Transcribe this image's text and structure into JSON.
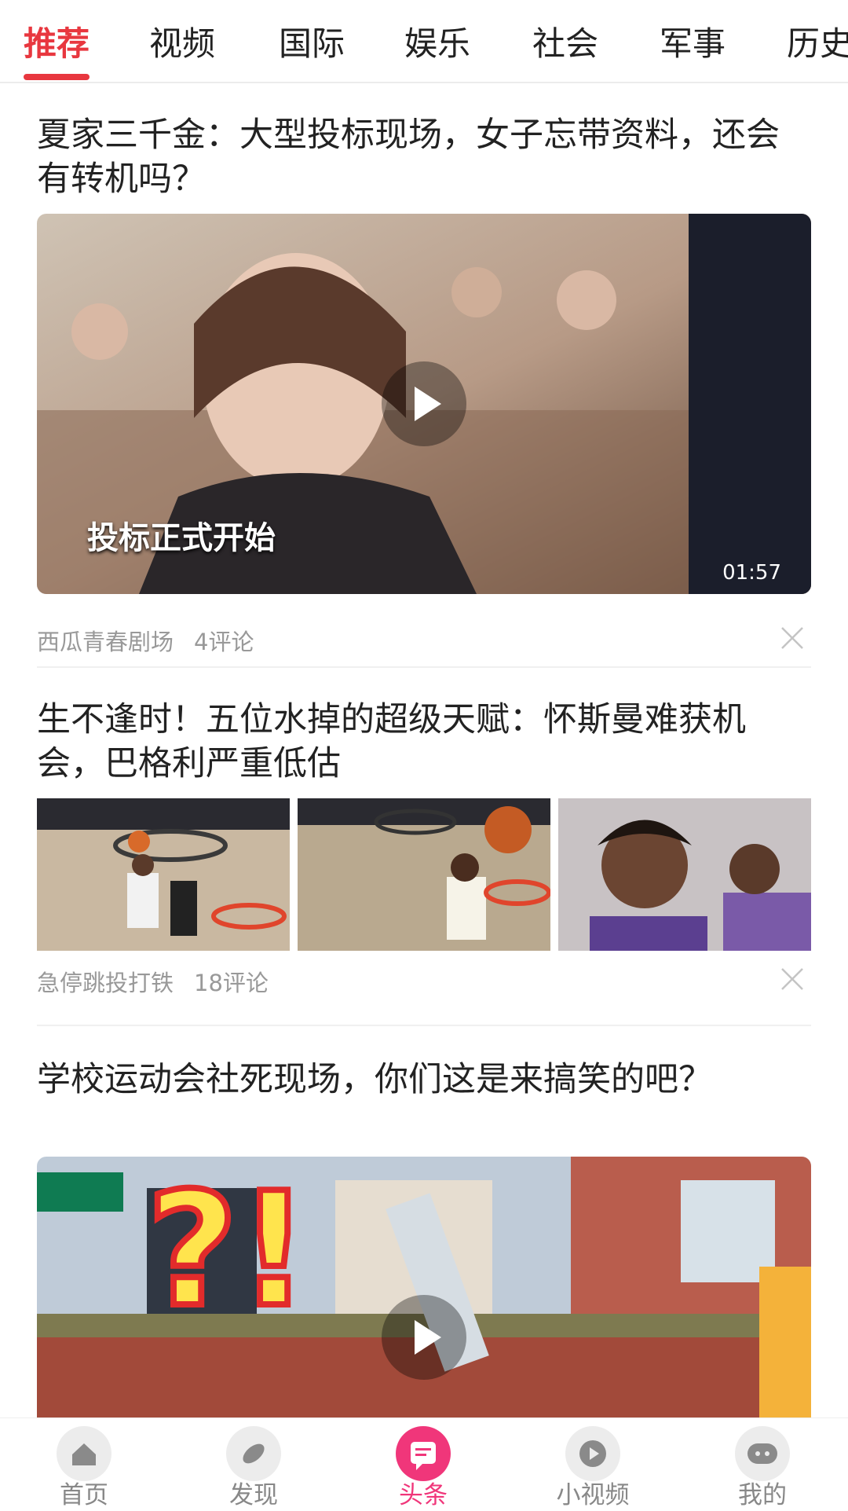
{
  "tabs": [
    "推荐",
    "视频",
    "国际",
    "娱乐",
    "社会",
    "军事",
    "历史"
  ],
  "active_tab": "推荐",
  "articles": [
    {
      "title": "夏家三千金：大型投标现场，女子忘带资料，还会有转机吗？",
      "thumbnail_caption": "投标正式开始",
      "duration": "01:57",
      "source": "西瓜青春剧场",
      "comments": "4评论"
    },
    {
      "title": "生不逢时！五位水掉的超级天赋：怀斯曼难获机会，巴格利严重低估",
      "source": "急停跳投打铁",
      "comments": "18评论"
    },
    {
      "title": "学校运动会社死现场，你们这是来搞笑的吧？",
      "thumbnail_caption": "?!"
    }
  ],
  "bottom_nav": [
    {
      "label": "首页",
      "icon": "home-icon"
    },
    {
      "label": "发现",
      "icon": "compass-icon"
    },
    {
      "label": "头条",
      "icon": "message-icon"
    },
    {
      "label": "小视频",
      "icon": "play-icon"
    },
    {
      "label": "我的",
      "icon": "chat-bubble-icon"
    }
  ],
  "active_nav": "头条",
  "colors": {
    "accent": "#e8373f",
    "nav_active": "#f0367a"
  }
}
